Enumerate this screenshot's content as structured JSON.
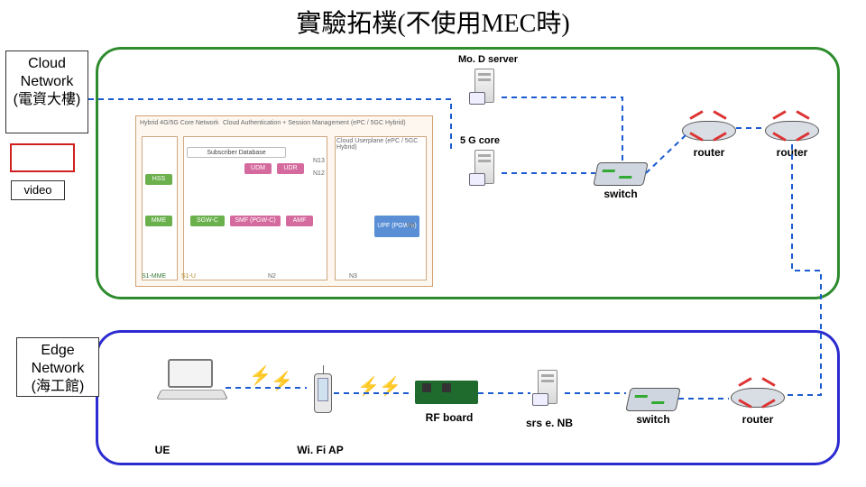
{
  "title": "實驗拓樸(不使用MEC時)",
  "cloud": {
    "box_label": "Cloud Network (電資大樓)",
    "video_label": "video",
    "mod_server": "Mo. D server",
    "core_5g": "5 G core",
    "switch": "switch",
    "router1": "router",
    "router2": "router",
    "core_arch": {
      "header_left": "Hybrid 4G/5G Core Network",
      "header_right": "Cloud Authentication + Session Management (ePC / 5GC Hybrid)",
      "col_left_top": "HSS",
      "col_left_bottom": "MME",
      "col_mid_top_1": "Subscriber Database",
      "col_mid_pink_1": "UDM",
      "col_mid_pink_2": "UDR",
      "col_mid_bottom_1": "SGW-C",
      "col_mid_bottom_2": "SMF (PGW-C)",
      "col_mid_bottom_3": "AMF",
      "col_right_header": "Cloud Userplane (ePC / 5GC Hybrid)",
      "col_right_1": "UPF (PGW-u)",
      "if_s1mme": "S1-MME",
      "if_s11": "S1-U",
      "if_n2": "N2",
      "if_n3": "N3",
      "if_n6": "N6",
      "if_n12": "N12",
      "if_n13": "N13"
    }
  },
  "edge": {
    "box_label": "Edge Network (海工館)",
    "ue": "UE",
    "wifi_ap": "Wi. Fi AP",
    "rf_board": "RF board",
    "srs_enb": "srs e. NB",
    "switch": "switch",
    "router": "router"
  }
}
